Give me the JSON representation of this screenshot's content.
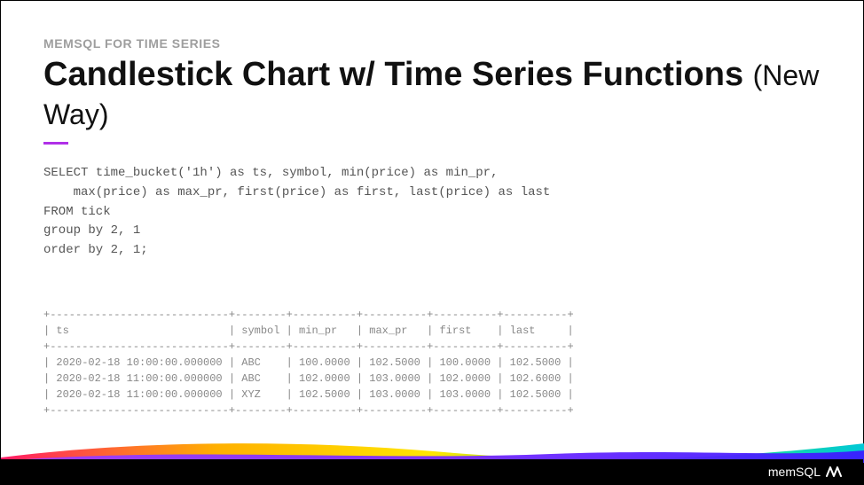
{
  "eyebrow": "MEMSQL FOR TIME SERIES",
  "title_main": "Candlestick Chart w/ Time Series Functions ",
  "title_sub": "(New Way)",
  "code": "SELECT time_bucket('1h') as ts, symbol, min(price) as min_pr,\n    max(price) as max_pr, first(price) as first, last(price) as last\nFROM tick\ngroup by 2, 1\norder by 2, 1;",
  "table": "+----------------------------+--------+----------+----------+----------+----------+\n| ts                         | symbol | min_pr   | max_pr   | first    | last     |\n+----------------------------+--------+----------+----------+----------+----------+\n| 2020-02-18 10:00:00.000000 | ABC    | 100.0000 | 102.5000 | 100.0000 | 102.5000 |\n| 2020-02-18 11:00:00.000000 | ABC    | 102.0000 | 103.0000 | 102.0000 | 102.6000 |\n| 2020-02-18 11:00:00.000000 | XYZ    | 102.5000 | 103.0000 | 103.0000 | 102.5000 |\n+----------------------------+--------+----------+----------+----------+----------+",
  "brand": "memSQL"
}
